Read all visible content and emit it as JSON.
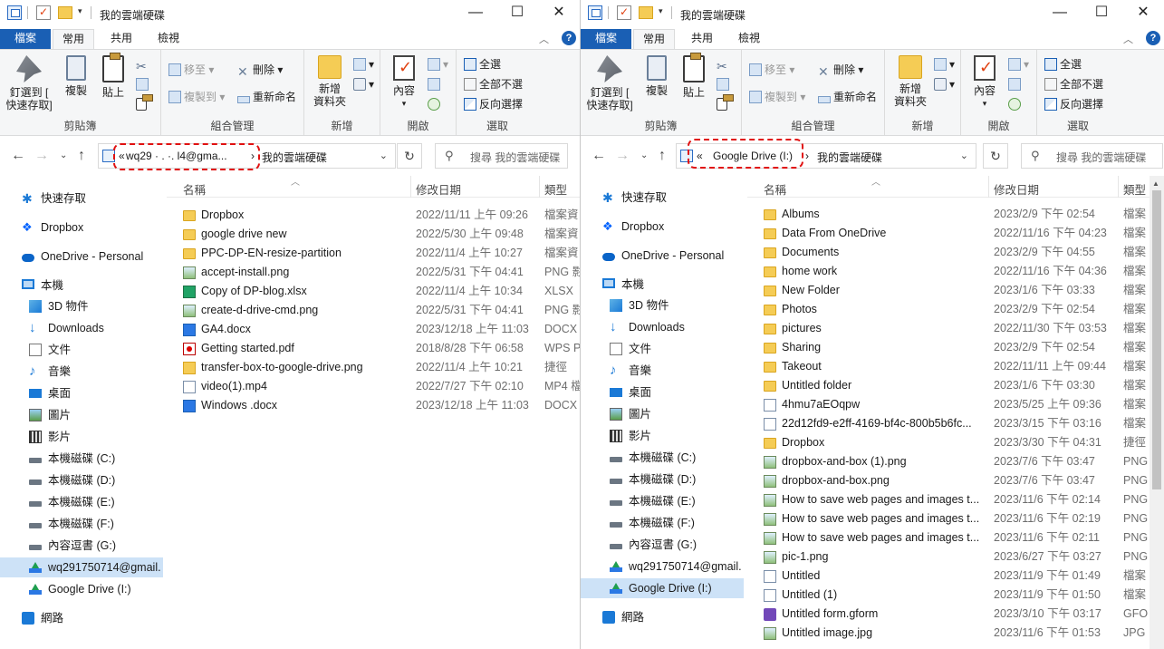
{
  "left": {
    "title": "我的雲端硬碟",
    "tabs": {
      "file": "檔案",
      "home": "常用",
      "share": "共用",
      "view": "檢視"
    },
    "ribbon": {
      "pin": "釘選到 [",
      "pin2": "快速存取]",
      "copy": "複製",
      "paste": "貼上",
      "clipboard": "剪貼簿",
      "move_to": "移至",
      "copy_to": "複製到",
      "delete": "刪除",
      "rename": "重新命名",
      "organize": "組合管理",
      "new_folder": "新增",
      "new_folder2": "資料夾",
      "new": "新增",
      "properties": "內容",
      "open": "開啟",
      "select_all": "全選",
      "select_none": "全部不選",
      "invert": "反向選擇",
      "select": "選取"
    },
    "address": {
      "prefix": "«",
      "root": "wq29 · . ·. l4@gma...",
      "sep": "›",
      "current": "我的雲端硬碟"
    },
    "search_placeholder": "搜尋 我的雲端硬碟",
    "columns": {
      "name": "名稱",
      "date": "修改日期",
      "type": "類型"
    },
    "nav": [
      "快速存取",
      "Dropbox",
      "OneDrive - Personal",
      "本機",
      "3D 物件",
      "Downloads",
      "文件",
      "音樂",
      "桌面",
      "圖片",
      "影片",
      "本機磁碟 (C:)",
      "本機磁碟 (D:)",
      "本機磁碟 (E:)",
      "本機磁碟 (F:)",
      "內容逗書 (G:)",
      "wq291750714@gmail.",
      "Google Drive (I:)",
      "網路"
    ],
    "files": [
      {
        "name": "Dropbox",
        "date": "2022/11/11 上午 09:26",
        "type": "檔案資",
        "icon": "folder"
      },
      {
        "name": "google drive new",
        "date": "2022/5/30 上午 09:48",
        "type": "檔案資",
        "icon": "folder"
      },
      {
        "name": "PPC-DP-EN-resize-partition",
        "date": "2022/11/4 上午 10:27",
        "type": "檔案資",
        "icon": "folder"
      },
      {
        "name": "accept-install.png",
        "date": "2022/5/31 下午 04:41",
        "type": "PNG 影",
        "icon": "img"
      },
      {
        "name": "Copy of DP-blog.xlsx",
        "date": "2022/11/4 上午 10:34",
        "type": "XLSX",
        "icon": "xlsx"
      },
      {
        "name": "create-d-drive-cmd.png",
        "date": "2022/5/31 下午 04:41",
        "type": "PNG 影",
        "icon": "img"
      },
      {
        "name": "GA4.docx",
        "date": "2023/12/18 上午 11:03",
        "type": "DOCX",
        "icon": "docx"
      },
      {
        "name": "Getting started.pdf",
        "date": "2018/8/28 下午 06:58",
        "type": "WPS P",
        "icon": "pdf"
      },
      {
        "name": "transfer-box-to-google-drive.png",
        "date": "2022/11/4 上午 10:21",
        "type": "捷徑",
        "icon": "link"
      },
      {
        "name": "video(1).mp4",
        "date": "2022/7/27 下午 02:10",
        "type": "MP4 檔",
        "icon": "file"
      },
      {
        "name": "Windows .docx",
        "date": "2023/12/18 上午 11:03",
        "type": "DOCX",
        "icon": "docx"
      }
    ]
  },
  "right": {
    "title": "我的雲端硬碟",
    "tabs": {
      "file": "檔案",
      "home": "常用",
      "share": "共用",
      "view": "檢視"
    },
    "ribbon": {
      "pin": "釘選到 [",
      "pin2": "快速存取]",
      "copy": "複製",
      "paste": "貼上",
      "clipboard": "剪貼簿",
      "move_to": "移至",
      "copy_to": "複製到",
      "delete": "刪除",
      "rename": "重新命名",
      "organize": "組合管理",
      "new_folder": "新增",
      "new_folder2": "資料夾",
      "new": "新增",
      "properties": "內容",
      "open": "開啟",
      "select_all": "全選",
      "select_none": "全部不選",
      "invert": "反向選擇",
      "select": "選取"
    },
    "address": {
      "prefix": "«",
      "root": "Google Drive (I:)",
      "sep": "›",
      "current": "我的雲端硬碟"
    },
    "search_placeholder": "搜尋 我的雲端硬碟",
    "columns": {
      "name": "名稱",
      "date": "修改日期",
      "type": "類型"
    },
    "nav": [
      "快速存取",
      "Dropbox",
      "OneDrive - Personal",
      "本機",
      "3D 物件",
      "Downloads",
      "文件",
      "音樂",
      "桌面",
      "圖片",
      "影片",
      "本機磁碟 (C:)",
      "本機磁碟 (D:)",
      "本機磁碟 (E:)",
      "本機磁碟 (F:)",
      "內容逗書 (G:)",
      "wq291750714@gmail.",
      "Google Drive (I:)",
      "網路"
    ],
    "files": [
      {
        "name": "Albums",
        "date": "2023/2/9 下午 02:54",
        "type": "檔案",
        "icon": "folder"
      },
      {
        "name": "Data From OneDrive",
        "date": "2022/11/16 下午 04:23",
        "type": "檔案",
        "icon": "folder"
      },
      {
        "name": "Documents",
        "date": "2023/2/9 下午 04:55",
        "type": "檔案",
        "icon": "folder"
      },
      {
        "name": "home work",
        "date": "2022/11/16 下午 04:36",
        "type": "檔案",
        "icon": "folder"
      },
      {
        "name": "New Folder",
        "date": "2023/1/6 下午 03:33",
        "type": "檔案",
        "icon": "folder"
      },
      {
        "name": "Photos",
        "date": "2023/2/9 下午 02:54",
        "type": "檔案",
        "icon": "folder"
      },
      {
        "name": "pictures",
        "date": "2022/11/30 下午 03:53",
        "type": "檔案",
        "icon": "folder"
      },
      {
        "name": "Sharing",
        "date": "2023/2/9 下午 02:54",
        "type": "檔案",
        "icon": "folder"
      },
      {
        "name": "Takeout",
        "date": "2022/11/11 上午 09:44",
        "type": "檔案",
        "icon": "folder"
      },
      {
        "name": "Untitled folder",
        "date": "2023/1/6 下午 03:30",
        "type": "檔案",
        "icon": "folder"
      },
      {
        "name": "4hmu7aEOqpw",
        "date": "2023/5/25 上午 09:36",
        "type": "檔案",
        "icon": "file"
      },
      {
        "name": "22d12fd9-e2ff-4169-bf4c-800b5b6fc...",
        "date": "2023/3/15 下午 03:16",
        "type": "檔案",
        "icon": "file"
      },
      {
        "name": "Dropbox",
        "date": "2023/3/30 下午 04:31",
        "type": "捷徑",
        "icon": "folder"
      },
      {
        "name": "dropbox-and-box (1).png",
        "date": "2023/7/6 下午 03:47",
        "type": "PNG",
        "icon": "img"
      },
      {
        "name": "dropbox-and-box.png",
        "date": "2023/7/6 下午 03:47",
        "type": "PNG",
        "icon": "img"
      },
      {
        "name": "How to save web pages and images t...",
        "date": "2023/11/6 下午 02:14",
        "type": "PNG",
        "icon": "img"
      },
      {
        "name": "How to save web pages and images t...",
        "date": "2023/11/6 下午 02:19",
        "type": "PNG",
        "icon": "img"
      },
      {
        "name": "How to save web pages and images t...",
        "date": "2023/11/6 下午 02:11",
        "type": "PNG",
        "icon": "img"
      },
      {
        "name": "pic-1.png",
        "date": "2023/6/27 下午 03:27",
        "type": "PNG",
        "icon": "img"
      },
      {
        "name": "Untitled",
        "date": "2023/11/9 下午 01:49",
        "type": "檔案",
        "icon": "file"
      },
      {
        "name": "Untitled (1)",
        "date": "2023/11/9 下午 01:50",
        "type": "檔案",
        "icon": "file"
      },
      {
        "name": "Untitled form.gform",
        "date": "2023/3/10 下午 03:17",
        "type": "GFO",
        "icon": "gform"
      },
      {
        "name": "Untitled image.jpg",
        "date": "2023/11/6 下午 01:53",
        "type": "JPG",
        "icon": "img"
      }
    ]
  }
}
